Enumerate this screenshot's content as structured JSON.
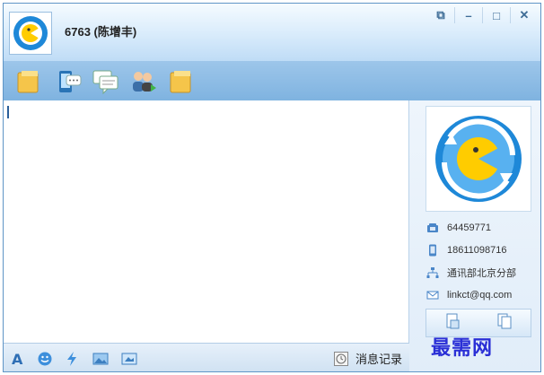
{
  "header": {
    "contact_title": "6763 (陈增丰)"
  },
  "window_controls": [
    {
      "icon": "restore-small-icon",
      "glyph": "⧉"
    },
    {
      "icon": "minimize-icon",
      "glyph": "–"
    },
    {
      "icon": "maximize-icon",
      "glyph": "□"
    },
    {
      "icon": "close-icon",
      "glyph": "✕"
    }
  ],
  "toolbar": {
    "icons": [
      "folder-icon",
      "phone-chat-icon",
      "group-chat-icon",
      "add-contacts-icon",
      "file-folder-icon"
    ]
  },
  "side_panel": {
    "phone": "64459771",
    "mobile": "18611098716",
    "department": "通讯部北京分部",
    "email": "linkct@qq.com"
  },
  "bottom_bar": {
    "history_label": "消息记录"
  },
  "watermark": {
    "text": "最需网"
  },
  "colors": {
    "titlebar_top": "#f5fbff",
    "toolbar": "#8fbde6",
    "accent": "#2b5f9a",
    "logo_blue": "#1e88d8",
    "logo_yellow": "#ffcc00"
  }
}
